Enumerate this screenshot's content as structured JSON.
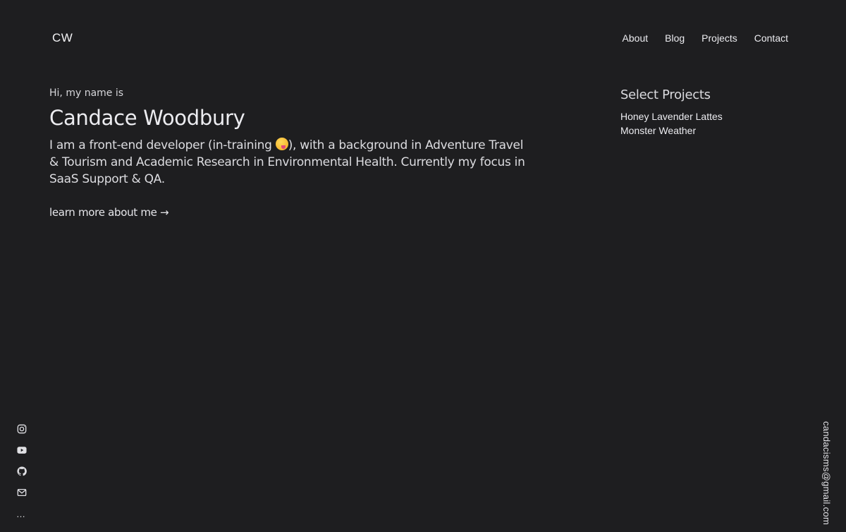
{
  "header": {
    "logo": "CW",
    "nav": [
      {
        "label": "About"
      },
      {
        "label": "Blog"
      },
      {
        "label": "Projects"
      },
      {
        "label": "Contact"
      }
    ]
  },
  "intro": {
    "greeting": "Hi, my name is",
    "name": "Candace Woodbury",
    "bio_before_emoji": "I am a front-end developer (in-training ",
    "bio_after_emoji": "), with a background in Adventure Travel & Tourism and Academic Research in Environmental Health. Currently my focus in SaaS Support & QA.",
    "learn_more": "learn more about me →"
  },
  "projects": {
    "heading": "Select Projects",
    "items": [
      {
        "label": "Honey Lavender Lattes"
      },
      {
        "label": "Monster Weather"
      }
    ]
  },
  "social": {
    "icons": [
      "instagram-icon",
      "youtube-icon",
      "github-icon",
      "mail-icon"
    ],
    "more": "…"
  },
  "contact": {
    "email": "candacisms@gmail.com"
  },
  "colors": {
    "background": "#1e1e20",
    "text": "#ececf0"
  }
}
